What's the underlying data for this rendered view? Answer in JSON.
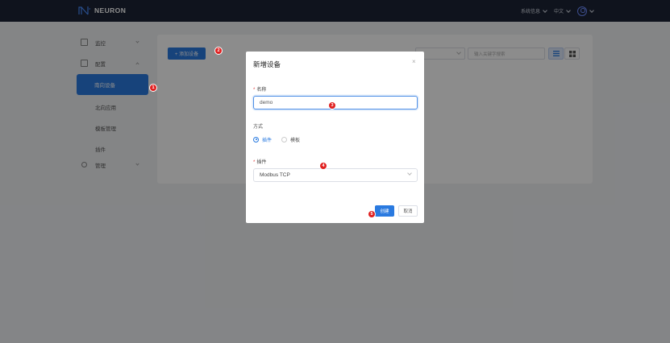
{
  "header": {
    "logo_text": "NEURON",
    "system_info": "系统信息",
    "language": "中文",
    "colors": {
      "bg": "#1c2436",
      "accent": "#2a7ae0"
    }
  },
  "sidebar": {
    "items": [
      {
        "label": "监控",
        "icon": "monitor-icon",
        "chevron": "down-icon"
      },
      {
        "label": "配置",
        "icon": "config-icon",
        "chevron": "up-icon"
      },
      {
        "label": "南向设备",
        "active": true
      },
      {
        "label": "北向应用"
      },
      {
        "label": "模板管理"
      },
      {
        "label": "插件"
      },
      {
        "label": "管理",
        "icon": "user-icon",
        "chevron": "down-icon"
      }
    ]
  },
  "toolbar": {
    "add_label": "+ 添加设备",
    "search_placeholder": "输入关键字搜索",
    "list_icon": "list-view-icon",
    "grid_icon": "grid-view-icon"
  },
  "modal": {
    "title": "新增设备",
    "close": "×",
    "name_label": "名称",
    "name_value": "demo",
    "mode_label": "方式",
    "mode_options": [
      "插件",
      "模板"
    ],
    "mode_selected": "插件",
    "plugin_label": "插件",
    "plugin_value": "Modbus TCP",
    "create_label": "创建",
    "cancel_label": "取消"
  },
  "markers": [
    "1",
    "2",
    "3",
    "4",
    "5"
  ]
}
